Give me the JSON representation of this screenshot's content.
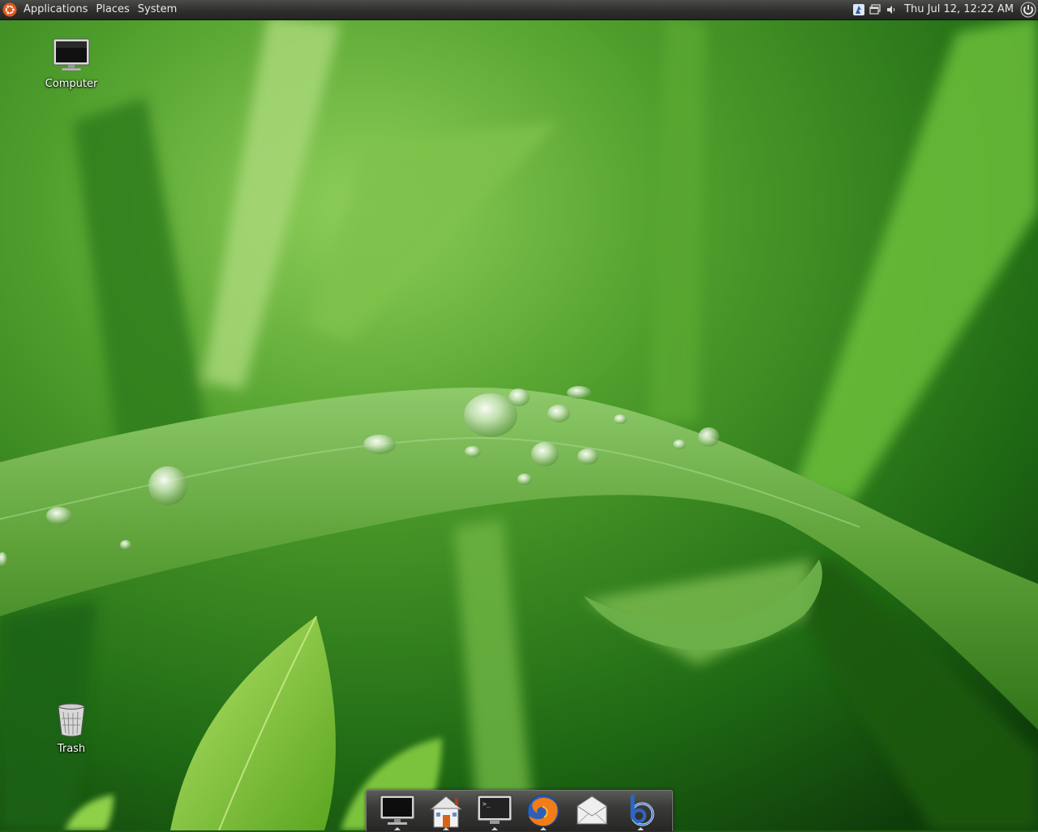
{
  "top_panel": {
    "menus": [
      "Applications",
      "Places",
      "System"
    ],
    "clock": "Thu Jul 12, 12:22 AM",
    "tray_icons": [
      "network-manager-icon",
      "window-switcher-icon",
      "volume-icon",
      "shutdown-icon"
    ]
  },
  "desktop": {
    "icons": [
      {
        "label": "Computer",
        "icon": "computer-icon"
      },
      {
        "label": "Trash",
        "icon": "trash-icon"
      }
    ]
  },
  "dock": {
    "items": [
      {
        "icon": "computer-launcher-icon",
        "running": true
      },
      {
        "icon": "home-folder-icon",
        "running": true
      },
      {
        "icon": "terminal-icon",
        "running": true
      },
      {
        "icon": "firefox-icon",
        "running": true
      },
      {
        "icon": "mail-icon",
        "running": false
      },
      {
        "icon": "blogging-app-icon",
        "running": true
      }
    ]
  },
  "colors": {
    "panel_bg": "#2f302d",
    "panel_text": "#e8e8e8",
    "ubuntu_orange": "#e05a1e",
    "wallpaper_green": "#2f7a1c"
  }
}
